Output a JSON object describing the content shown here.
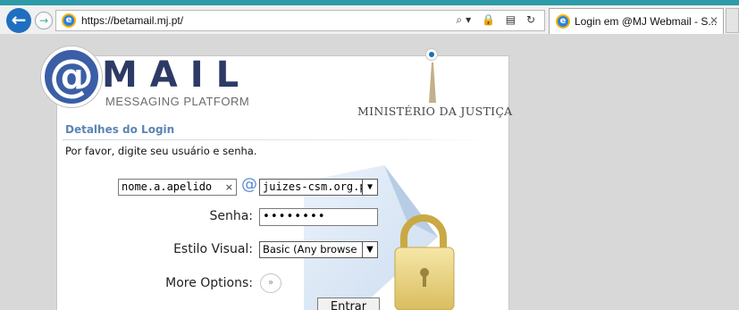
{
  "browser": {
    "url": "https://betamail.mj.pt/",
    "tab_title": "Login em @MJ Webmail - S...",
    "back_icon": "back-arrow-icon",
    "forward_icon": "forward-arrow-icon",
    "page_icon": "ie-icon"
  },
  "header": {
    "logo_symbol": "@",
    "logo_word": "MAIL",
    "logo_subtitle": "MESSAGING PLATFORM",
    "ministry": "MINISTÉRIO DA JUSTIÇA"
  },
  "login": {
    "section_title": "Detalhes do Login",
    "instructions": "Por favor, digite seu usuário e senha.",
    "username_value": "nome.a.apelido",
    "clear_glyph": "×",
    "at_glyph": "@",
    "domain_value": "juizes-csm.org.pt",
    "password_label": "Senha:",
    "password_value": "••••••••",
    "style_label": "Estilo Visual:",
    "style_value": "Basic (Any browse",
    "more_label": "More Options:",
    "more_glyph": "»",
    "submit_label": "Entrar"
  },
  "colors": {
    "accent": "#2d9ca8",
    "logo_blue": "#3b5ea6",
    "section_title": "#5a86b2"
  }
}
